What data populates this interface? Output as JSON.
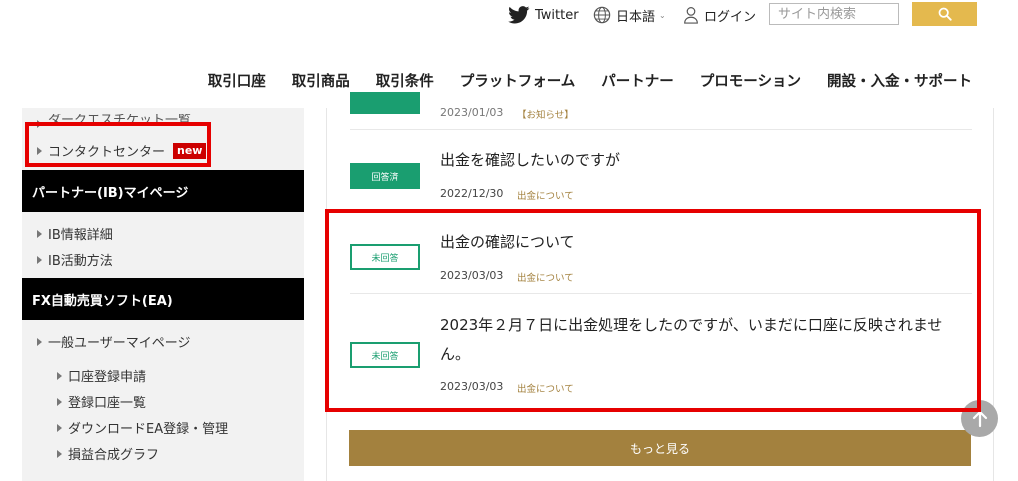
{
  "topbar": {
    "twitter_label": "Twitter",
    "language_label": "日本語",
    "login_label": "ログイン",
    "search_placeholder": "サイト内検索"
  },
  "nav": {
    "items": [
      "取引口座",
      "取引商品",
      "取引条件",
      "プラットフォーム",
      "パートナー",
      "プロモーション",
      "開設・入金・サポート"
    ]
  },
  "sidebar": {
    "cut_item": "ダークエスチケット一覧",
    "contact_label": "コンタクトセンター",
    "new_badge": "new",
    "partner_header": "パートナー(IB)マイページ",
    "partner_items": [
      "IB情報詳細",
      "IB活動方法"
    ],
    "ea_header": "FX自動売買ソフト(EA)",
    "general_user": "一般ユーザーマイページ",
    "ea_items": [
      "口座登録申請",
      "登録口座一覧",
      "ダウンロードEA登録・管理",
      "損益合成グラフ"
    ]
  },
  "questions": [
    {
      "date": "2023/01/03",
      "category": "【お知らせ】"
    },
    {
      "status": "回答済",
      "title": "出金を確認したいのですが",
      "date": "2022/12/30",
      "category": "出金について"
    },
    {
      "status": "未回答",
      "title": "出金の確認について",
      "date": "2023/03/03",
      "category": "出金について"
    },
    {
      "status": "未回答",
      "title": "2023年２月７日に出金処理をしたのですが、いまだに口座に反映されません。",
      "date": "2023/03/03",
      "category": "出金について"
    }
  ],
  "more_button": "もっと見る",
  "colors": {
    "accent_gold": "#a3813e",
    "status_green": "#1a9e70",
    "highlight_red": "#e60000",
    "search_yellow": "#e4b94e"
  },
  "icons": {
    "twitter": "twitter-icon",
    "globe": "globe-icon",
    "user": "user-icon",
    "search": "search-icon",
    "scroll_top": "arrow-up-icon"
  }
}
